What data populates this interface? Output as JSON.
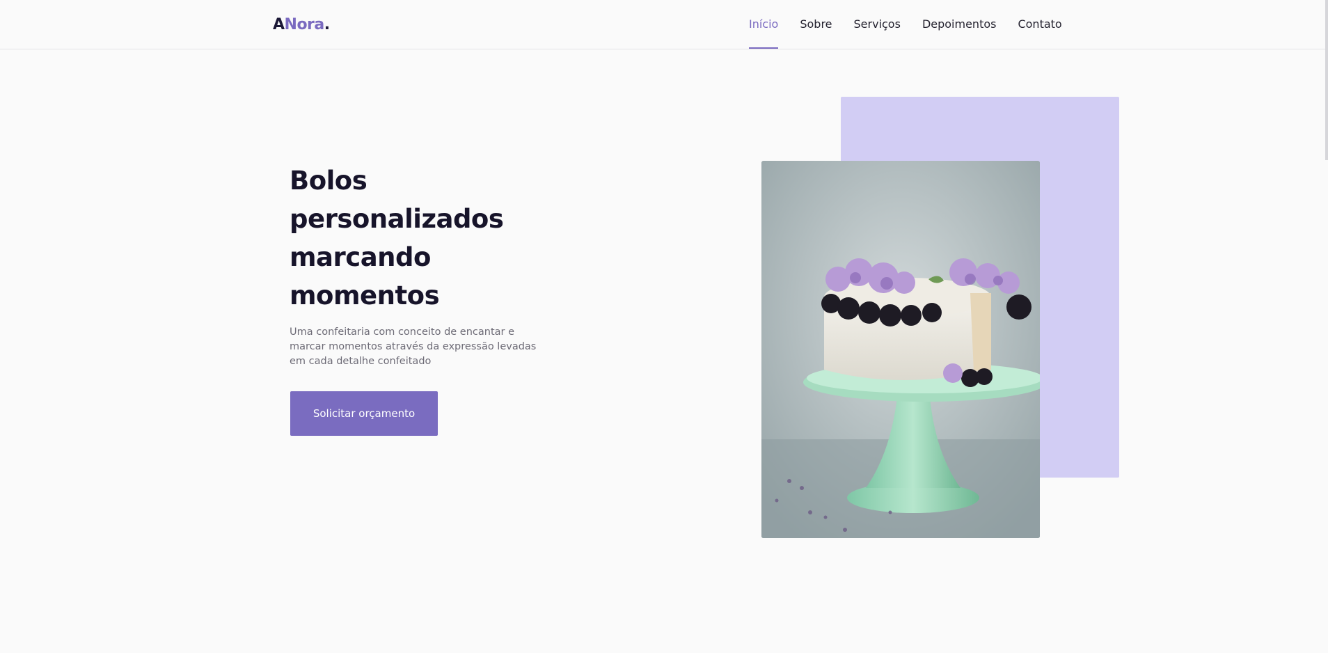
{
  "brand": {
    "logo_a": "A",
    "logo_name": "Nora",
    "logo_dot": "."
  },
  "nav": {
    "items": [
      {
        "label": "Início",
        "active": true
      },
      {
        "label": "Sobre",
        "active": false
      },
      {
        "label": "Serviços",
        "active": false
      },
      {
        "label": "Depoimentos",
        "active": false
      },
      {
        "label": "Contato",
        "active": false
      }
    ]
  },
  "hero": {
    "title": "Bolos personalizados marcando momentos",
    "description": "Uma confeitaria com conceito de encantar e marcar momentos através da expressão levadas em cada detalhe confeitado",
    "cta_label": "Solicitar orçamento"
  },
  "colors": {
    "accent": "#7a6ac0",
    "accent_light": "#d2cdf4",
    "heading": "#17142a",
    "body_text": "#6d6b76",
    "background": "#fafafa"
  },
  "icons": {
    "hero_image": "cake-photo"
  }
}
